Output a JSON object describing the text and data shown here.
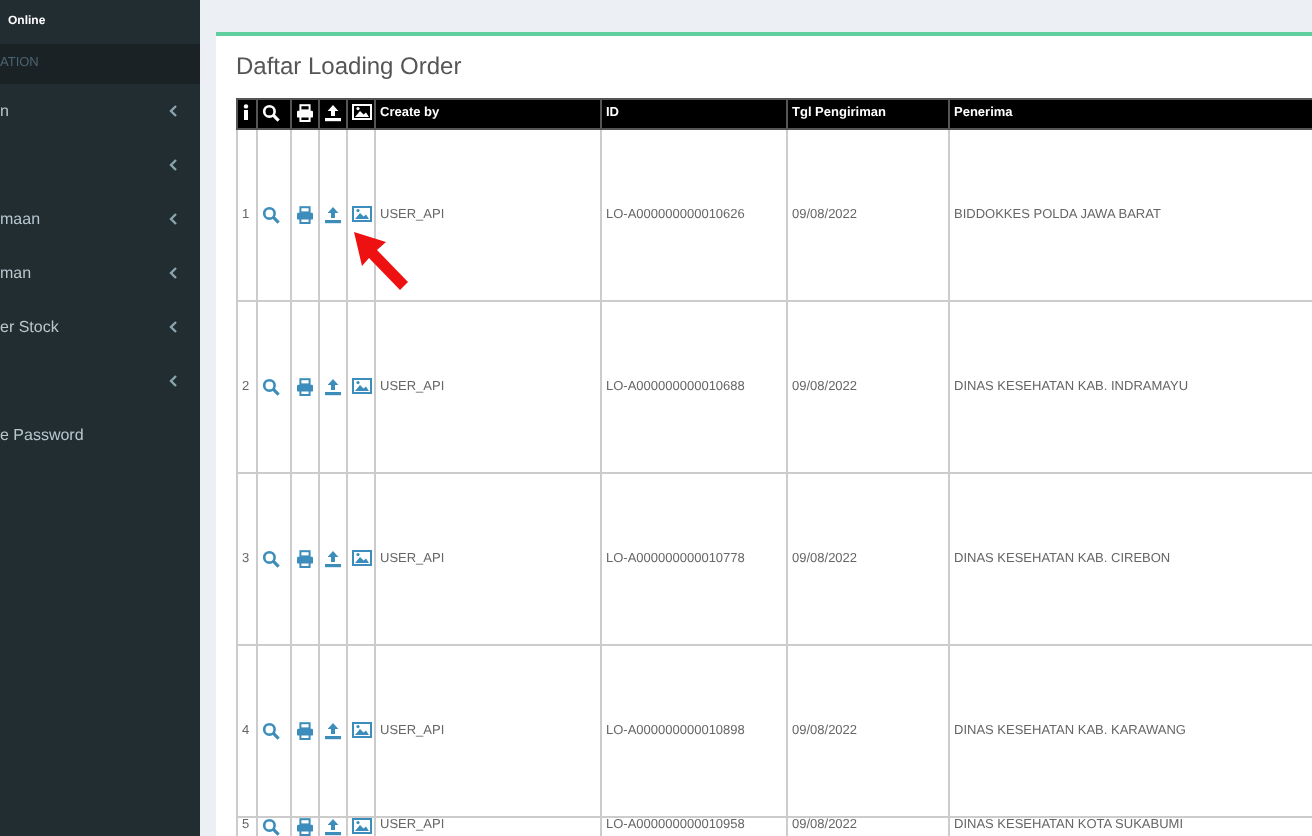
{
  "sidebar": {
    "status": "Online",
    "section": "ATION",
    "items": [
      {
        "label": "n",
        "has_submenu": true
      },
      {
        "has_submenu": true
      },
      {
        "label": "maan",
        "has_submenu": true
      },
      {
        "label": "man",
        "has_submenu": true
      },
      {
        "label": "er Stock",
        "has_submenu": true
      },
      {
        "has_submenu": true
      },
      {
        "label": "e Password",
        "has_submenu": false
      }
    ]
  },
  "panel": {
    "title": "Daftar Loading Order"
  },
  "table": {
    "columns": [
      {
        "kind": "info"
      },
      {
        "kind": "view"
      },
      {
        "kind": "print"
      },
      {
        "kind": "upload"
      },
      {
        "kind": "image"
      },
      {
        "kind": "text",
        "label": "Create by"
      },
      {
        "kind": "text",
        "label": "ID"
      },
      {
        "kind": "text",
        "label": "Tgl Pengiriman"
      },
      {
        "kind": "text",
        "label": "Penerima"
      }
    ],
    "rows": [
      {
        "no": "1",
        "create_by": "USER_API",
        "id": "LO-A000000000010626",
        "tgl": "09/08/2022",
        "penerima": "BIDDOKKES POLDA JAWA BARAT"
      },
      {
        "no": "2",
        "create_by": "USER_API",
        "id": "LO-A000000000010688",
        "tgl": "09/08/2022",
        "penerima": "DINAS KESEHATAN KAB. INDRAMAYU"
      },
      {
        "no": "3",
        "create_by": "USER_API",
        "id": "LO-A000000000010778",
        "tgl": "09/08/2022",
        "penerima": "DINAS KESEHATAN KAB. CIREBON"
      },
      {
        "no": "4",
        "create_by": "USER_API",
        "id": "LO-A000000000010898",
        "tgl": "09/08/2022",
        "penerima": "DINAS KESEHATAN KAB. KARAWANG"
      },
      {
        "no": "5",
        "create_by": "USER_API",
        "id": "LO-A000000000010958",
        "tgl": "09/08/2022",
        "penerima": "DINAS KESEHATAN KOTA SUKABUMI"
      }
    ]
  },
  "annotation": {
    "kind": "arrow"
  }
}
